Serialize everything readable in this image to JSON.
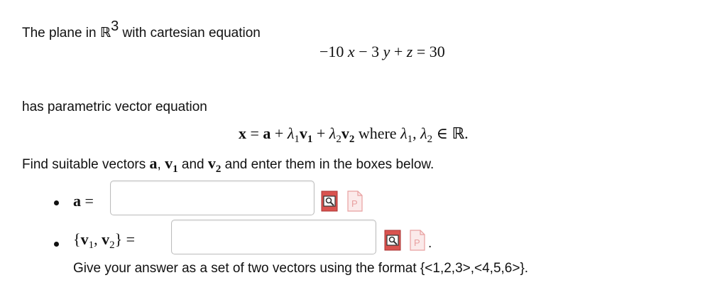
{
  "intro": {
    "text": "The plane in",
    "set_symbol": "ℝ",
    "set_exponent": "3",
    "text_after": "with cartesian equation"
  },
  "cartesian_equation": {
    "c1": "−10",
    "v1": "x",
    "op1": "−",
    "c2": "3",
    "v2": "y",
    "op2": "+",
    "v3": "z",
    "eq": "=",
    "rhs": "30"
  },
  "parametric_intro": "has parametric vector equation",
  "vector_equation": {
    "x": "x",
    "eq": "=",
    "a": "a",
    "plus1": "+",
    "lambda": "λ",
    "sub1": "1",
    "v": "v",
    "plus2": "+",
    "sub2": "2",
    "where": "where",
    "comma": ",",
    "in": "∈",
    "reals": "ℝ",
    "period": "."
  },
  "find": {
    "text1": "Find suitable vectors",
    "a": "a",
    "comma": ",",
    "v": "v",
    "sub1": "1",
    "and": "and",
    "sub2": "2",
    "text2": "and enter them in the boxes below."
  },
  "answer_a": {
    "label": "a",
    "eq": "=",
    "value": "",
    "preview_icon": "preview-icon",
    "syntax_icon": "syntax-help-icon"
  },
  "answer_v": {
    "open": "{",
    "v": "v",
    "sub1": "1",
    "comma": ",",
    "sub2": "2",
    "close": "}",
    "eq": "=",
    "value": "",
    "preview_icon": "preview-icon",
    "syntax_icon": "syntax-help-icon",
    "trailing": "."
  },
  "hint": "Give your answer as a set of two vectors using the format {<1,2,3>,<4,5,6>}.",
  "colors": {
    "preview_icon": "#d9534f",
    "syntax_icon": "#e8a0a0",
    "field_border": "#bcbcbc"
  }
}
